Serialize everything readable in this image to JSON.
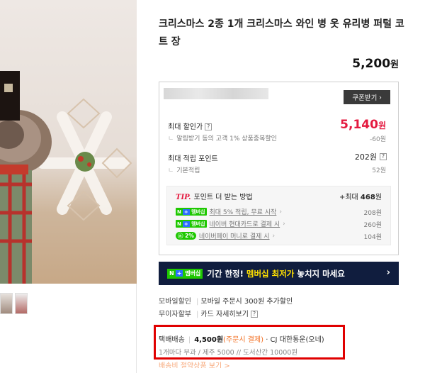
{
  "product": {
    "title": "크리스마스 2종 1개 크리스마스 와인 병 옷 유리병 퍼털 코트 장",
    "price_value": "5,200",
    "price_unit": "원"
  },
  "benefits": {
    "coupon_button": "쿠폰받기",
    "max_discount_label": "최대 할인가",
    "max_discount_value": "5,140",
    "max_discount_unit": "원",
    "discount_note": "알림받기 동의 고객 1% 상품중복할인",
    "discount_note_amount": "-60원",
    "max_points_label": "최대 적립 포인트",
    "max_points_value": "202원",
    "basic_points_label": "기본적립",
    "basic_points_value": "52원",
    "tip": {
      "prefix": "TIP.",
      "heading": "포인트 더 받는 방법",
      "max_prefix": "+최대",
      "max_value": "468",
      "max_unit": "원",
      "rows": [
        {
          "badge": "멤버십",
          "text": "최대 5% 적립, 무료 시작",
          "amount": "208원"
        },
        {
          "badge": "멤버십",
          "text": "네이버 현대카드로 결제 시",
          "amount": "260원"
        },
        {
          "badge": "2%",
          "text": "네이버페이 머니로 결제 시",
          "amount": "104원"
        }
      ]
    }
  },
  "promo": {
    "badge": "멤버십",
    "text_before": "기간 한정! ",
    "highlight": "멤버십 최저가",
    "text_after": " 놓치지 마세요"
  },
  "mobile": {
    "label": "모바일할인",
    "text": "모바일 주문시 300원 추가할인"
  },
  "installment": {
    "label": "무이자할부",
    "text": "카드 자세히보기"
  },
  "shipping": {
    "label": "택배배송",
    "fee": "4,500원",
    "pay_note": "(주문시 결제)",
    "carrier": "· CJ 대한통운(오네)",
    "detail": "1개마다 부과 / 제주 5000 // 도서산간 10000원",
    "cut_link": "배송비 절약상품 보기 >"
  },
  "colors": {
    "accent_red": "#e4193f",
    "naver_green": "#1ec800",
    "promo_bg": "#101d3e",
    "highlight_box": "#e00000"
  }
}
